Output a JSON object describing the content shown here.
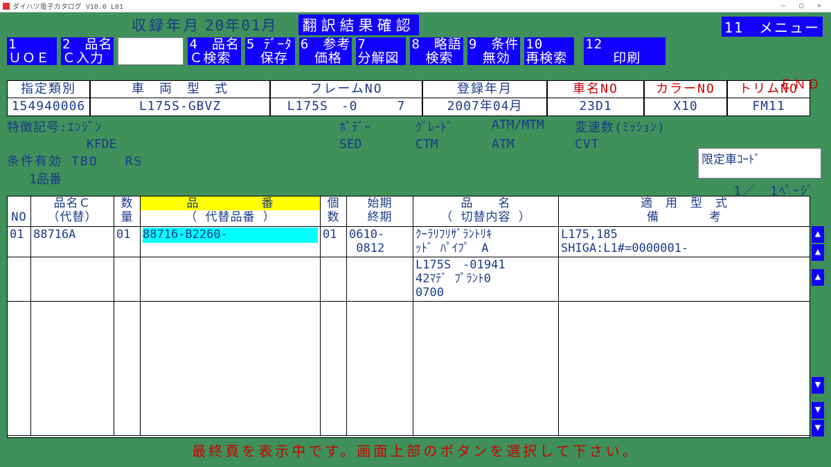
{
  "titlebar": {
    "text": "ダイハツ電子カタログ V10.0 L01"
  },
  "top": {
    "rec_label": "収録年月",
    "rec_value": "20年01月",
    "trans_badge": "翻訳結果確認",
    "menu11": "11　メニュー"
  },
  "hotkeys": [
    {
      "l1": "1",
      "l2": "ＵＯＥ"
    },
    {
      "l1": "2　品名",
      "l2": "Ｃ入力"
    },
    {
      "l1": "4　品名",
      "l2": "Ｃ検索"
    },
    {
      "l1": "5 ﾃﾞｰﾀ",
      "l2": "　保存"
    },
    {
      "l1": "6　参考",
      "l2": "　価格"
    },
    {
      "l1": "7",
      "l2": "分解図"
    },
    {
      "l1": "8　略語",
      "l2": "　検索"
    },
    {
      "l1": "9　条件",
      "l2": "　無効"
    },
    {
      "l1": "10",
      "l2": "再検索"
    },
    {
      "l1": "12",
      "l2": "　　印刷"
    }
  ],
  "end_label": "ＥＮＤ",
  "veh": {
    "hdr": [
      "指定類別",
      "車　両　型　式",
      "フレームNO",
      "登録年月",
      "車名NO",
      "カラーNO",
      "トリムNO"
    ],
    "val": [
      "154940006",
      "L175S-GBVZ",
      "L175S　-0　　　7",
      "2007年04月",
      "23D1",
      "X10",
      "FM11"
    ]
  },
  "feat": {
    "label": "特徴記号:ｴﾝｼﾞﾝ",
    "engine": "KFDE",
    "body_l": "ﾎﾞﾃﾞｰ",
    "body_v": "SED",
    "grade_l": "ｸﾞﾚｰﾄﾞ",
    "grade_v": "CTM",
    "atm_l": "ATM/MTM",
    "atm_v": "ATM",
    "gear_l": "変速数(ﾐｯｼｮﾝ)",
    "gear_v": "CVT"
  },
  "cond": {
    "label": "条件有効",
    "v1": "TBO",
    "v2": "RS",
    "pn1": "1品番"
  },
  "limited_label": "限定車ｺｰﾄﾞ",
  "page_indicator": "1／　1ﾍﾟｰｼﾞ",
  "grid": {
    "hdr": {
      "no": "NO",
      "pnc": "品名Ｃ\n（代替）",
      "qty": "数\n量",
      "pnum_top": "品　　　　　番",
      "pnum_bot": "（ 代替品番 ）",
      "cnt": "個\n数",
      "date": "始期\n終期",
      "name": "品　　名\n（ 切替内容 ）",
      "spec": "適　用　型　式\n備　　　　考"
    },
    "rows": [
      {
        "no": "01",
        "pnc": "88716A",
        "qty": "01",
        "pnum": "88716-B2260-",
        "cnt": "01",
        "date": "0610-\n 0812",
        "name": "ｸｰﾗﾘﾌﾘｻﾞﾗﾝﾄﾘｷ\nｯﾄﾞ ﾊﾟｲﾌﾟ　A",
        "spec": "L175,185\nSHIGA:L1#=0000001-"
      },
      {
        "no": "",
        "pnc": "",
        "qty": "",
        "pnum": "",
        "cnt": "",
        "date": "",
        "name": "L175S　-01941\n42ﾏﾃﾞ ﾌﾟﾗﾝﾄ0\n0700",
        "spec": ""
      }
    ]
  },
  "status": "最終頁を表示中です。画面上部のボタンを選択して下さい。"
}
